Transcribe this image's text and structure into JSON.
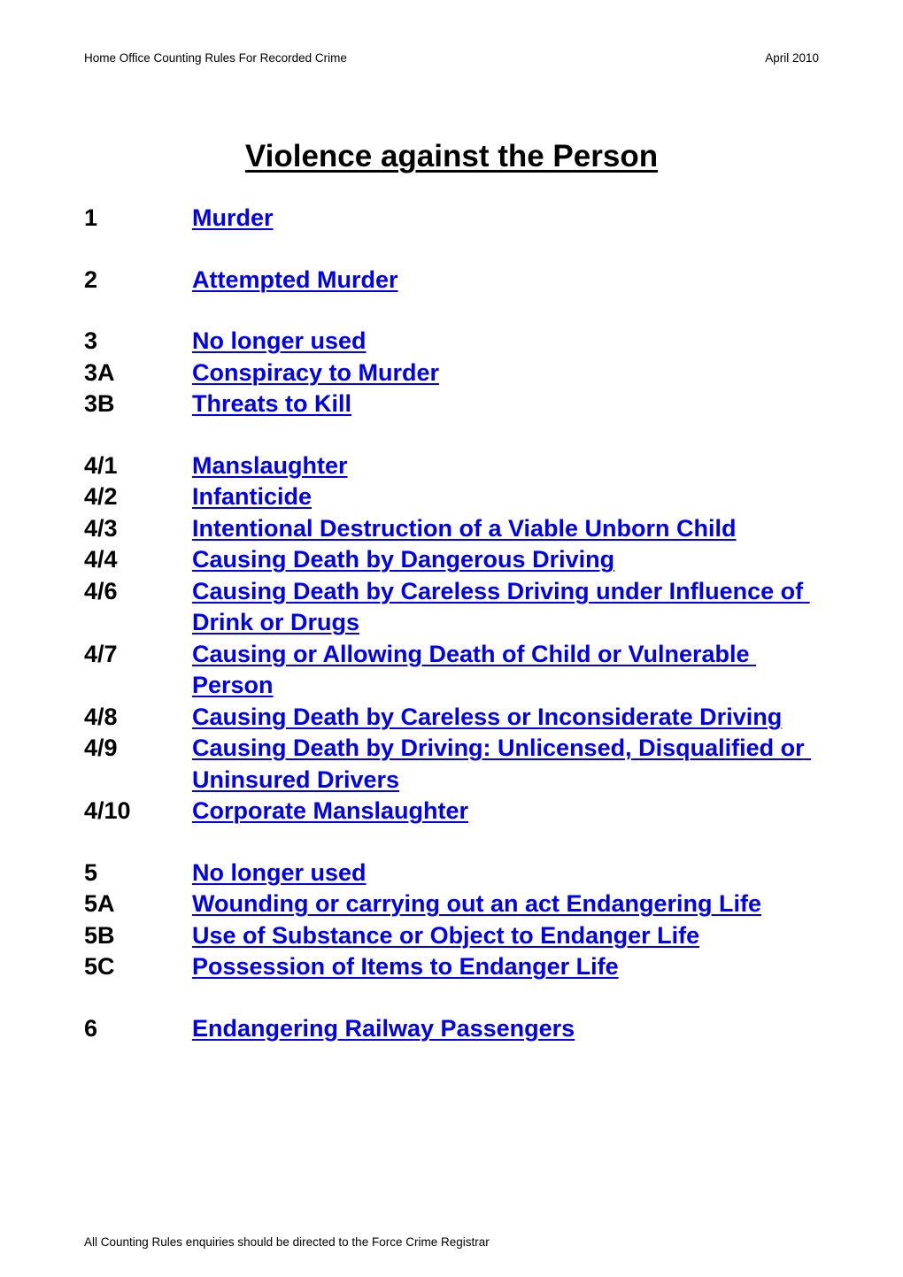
{
  "header": {
    "left": "Home Office Counting Rules For Recorded Crime",
    "right": "April 2010"
  },
  "title": "Violence against the Person",
  "groups": [
    {
      "id": "group-1",
      "rows": [
        {
          "code": "1",
          "label": "Murder"
        }
      ]
    },
    {
      "id": "group-2",
      "rows": [
        {
          "code": "2",
          "label": "Attempted Murder"
        }
      ]
    },
    {
      "id": "group-3",
      "rows": [
        {
          "code": "3",
          "label": "No longer used"
        },
        {
          "code": "3A",
          "label": "Conspiracy to Murder"
        },
        {
          "code": "3B",
          "label": "Threats to Kill"
        }
      ]
    },
    {
      "id": "group-4",
      "rows": [
        {
          "code": "4/1",
          "label": "Manslaughter"
        },
        {
          "code": "4/2",
          "label": "Infanticide"
        },
        {
          "code": "4/3",
          "label": "Intentional Destruction of a Viable Unborn Child"
        },
        {
          "code": "4/4",
          "label": "Causing Death by Dangerous Driving"
        },
        {
          "code": "4/6",
          "label": "Causing Death by Careless Driving under Influence of Drink or Drugs"
        },
        {
          "code": "4/7",
          "label": "Causing or Allowing Death of Child or Vulnerable Person"
        },
        {
          "code": "4/8",
          "label": "Causing Death by Careless or Inconsiderate Driving"
        },
        {
          "code": "4/9",
          "label": "Causing Death by Driving: Unlicensed, Disqualified or Uninsured Drivers"
        },
        {
          "code": "4/10",
          "label": "Corporate Manslaughter"
        }
      ]
    },
    {
      "id": "group-5",
      "rows": [
        {
          "code": "5",
          "label": "No longer used"
        },
        {
          "code": "5A",
          "label": "Wounding or carrying out an act Endangering Life"
        },
        {
          "code": "5B",
          "label": "Use of Substance or Object to Endanger Life"
        },
        {
          "code": "5C",
          "label": "Possession of Items to Endanger Life"
        }
      ]
    },
    {
      "id": "group-6",
      "rows": [
        {
          "code": "6",
          "label": "Endangering Railway Passengers"
        }
      ]
    }
  ],
  "footer": {
    "text": "All Counting Rules enquiries should be directed to the Force Crime Registrar"
  },
  "colors": {
    "link": "#0000ee",
    "text": "#000000",
    "background": "#ffffff"
  }
}
